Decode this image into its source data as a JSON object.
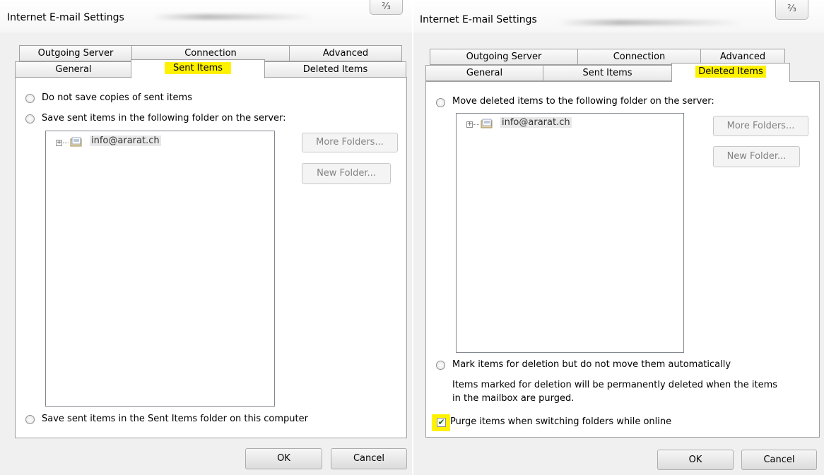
{
  "dialog1": {
    "title": "Internet E-mail Settings",
    "close_glyph": "⅔",
    "tabs_top": [
      "Outgoing Server",
      "Connection",
      "Advanced"
    ],
    "tabs_bottom": [
      "General",
      "Sent Items",
      "Deleted Items"
    ],
    "active_tab": "Sent Items",
    "option_no_save": "Do not save copies of sent items",
    "option_server": "Save sent items in the following folder on the server:",
    "tree_item": "info@ararat.ch",
    "more_folders": "More Folders...",
    "new_folder": "New Folder...",
    "option_local": "Save sent items in the Sent Items folder on this computer",
    "ok": "OK",
    "cancel": "Cancel"
  },
  "dialog2": {
    "title": "Internet E-mail Settings",
    "close_glyph": "⅔",
    "tabs_top": [
      "Outgoing Server",
      "Connection",
      "Advanced"
    ],
    "tabs_bottom": [
      "General",
      "Sent Items",
      "Deleted Items"
    ],
    "active_tab": "Deleted Items",
    "option_move": "Move deleted items to the following folder on the server:",
    "tree_item": "info@ararat.ch",
    "more_folders": "More Folders...",
    "new_folder": "New Folder...",
    "option_mark": "Mark items for deletion but do not move them automatically",
    "info_line1": "Items marked for deletion will be permanently deleted when the items",
    "info_line2": "in the mailbox are purged.",
    "purge_label": "Purge items when switching folders while online",
    "purge_checked": true,
    "ok": "OK",
    "cancel": "Cancel"
  },
  "colors": {
    "highlight": "#fff200",
    "dialog_bg": "#f0f0f0",
    "border": "#a0a0a0"
  }
}
